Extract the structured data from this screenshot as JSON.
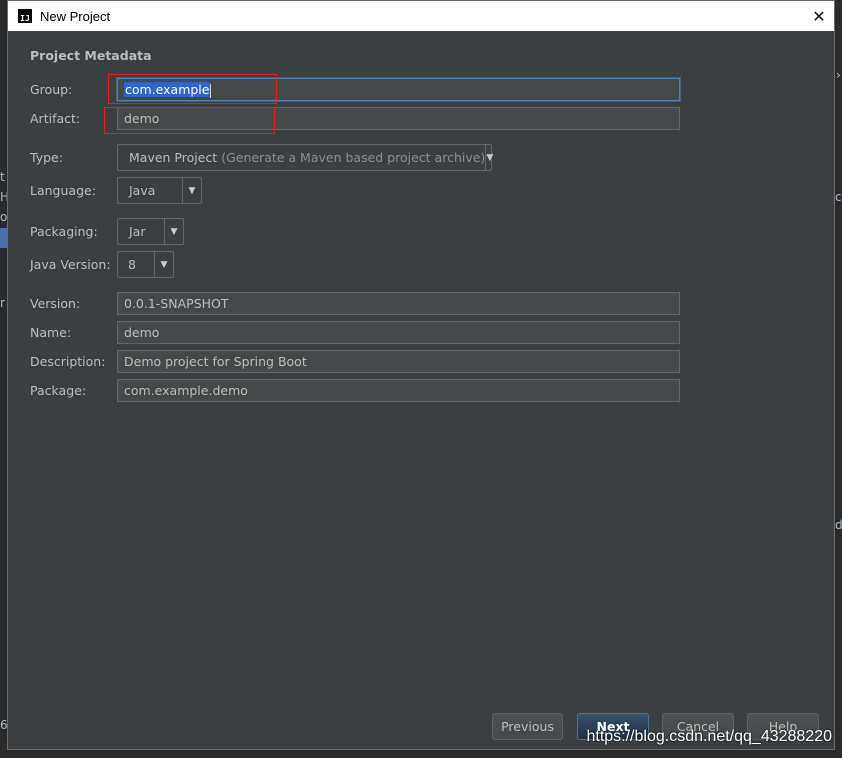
{
  "window": {
    "title": "New Project",
    "section_title": "Project Metadata"
  },
  "form": {
    "group": {
      "label": "Group:",
      "value": "com.example"
    },
    "artifact": {
      "label": "Artifact:",
      "value": "demo"
    },
    "type": {
      "label": "Type:",
      "value": "Maven Project",
      "hint": "(Generate a Maven based project archive)"
    },
    "language": {
      "label": "Language:",
      "value": "Java"
    },
    "packaging": {
      "label": "Packaging:",
      "value": "Jar"
    },
    "java_version": {
      "label": "Java Version:",
      "value": "8"
    },
    "version": {
      "label": "Version:",
      "value": "0.0.1-SNAPSHOT"
    },
    "name": {
      "label": "Name:",
      "value": "demo"
    },
    "description": {
      "label": "Description:",
      "value": "Demo project for Spring Boot"
    },
    "package": {
      "label": "Package:",
      "value": "com.example.demo"
    }
  },
  "buttons": {
    "previous": "Previous",
    "next": "Next",
    "cancel": "Cancel",
    "help": "Help"
  },
  "watermark": "https://blog.csdn.net/qq_43288220",
  "colors": {
    "dialog_bg": "#3c3f41",
    "field_bg": "#45494a",
    "selection": "#2f65ca",
    "annotation_red": "#e02020"
  },
  "icons": {
    "app": "intellij-icon",
    "close": "close-icon",
    "dropdown": "chevron-down-icon"
  }
}
